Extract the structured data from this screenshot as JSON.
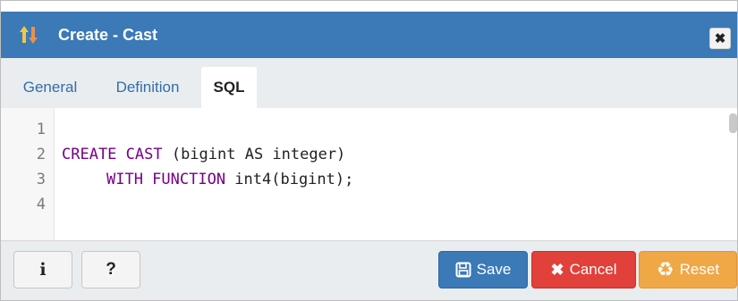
{
  "dialog": {
    "title": "Create - Cast",
    "icon": "cast-icon",
    "close_icon": "close-icon"
  },
  "tabs": [
    {
      "label": "General",
      "active": false
    },
    {
      "label": "Definition",
      "active": false
    },
    {
      "label": "SQL",
      "active": true
    }
  ],
  "editor": {
    "line_numbers": [
      "1",
      "2",
      "3",
      "4"
    ],
    "lines": [
      {
        "keyword": "",
        "rest": ""
      },
      {
        "keyword": "CREATE CAST",
        "rest": " (bigint AS integer)"
      },
      {
        "keyword": "WITH FUNCTION",
        "rest": " int4(bigint);"
      },
      {
        "keyword": "",
        "rest": ""
      }
    ]
  },
  "footer": {
    "info_label": "i",
    "help_label": "?",
    "save_label": "Save",
    "cancel_label": "Cancel",
    "reset_label": "Reset"
  },
  "colors": {
    "header": "#3b79b7",
    "keyword": "#770088",
    "save": "#3b79b7",
    "cancel": "#e2403a",
    "reset": "#f0a746"
  }
}
